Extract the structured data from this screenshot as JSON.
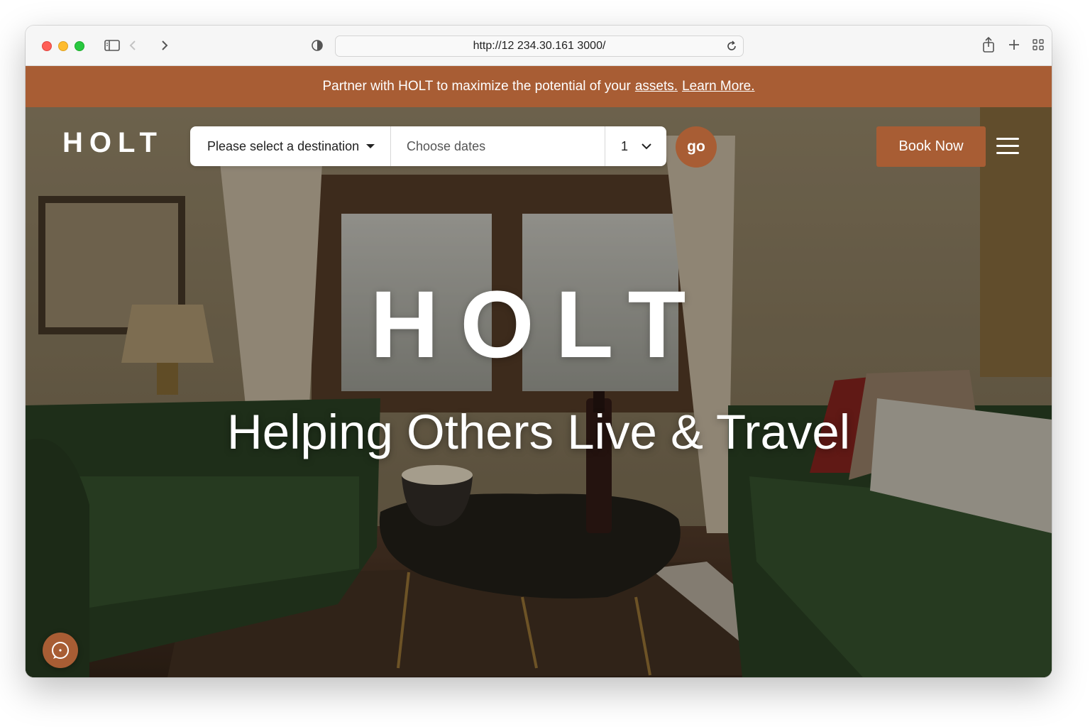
{
  "browser": {
    "url": "http://12 234.30.161 3000/"
  },
  "promo": {
    "text": "Partner with HOLT to maximize the potential of your",
    "assets_link": "assets.",
    "learn_more_link": "Learn More."
  },
  "nav": {
    "logo": "HOLT",
    "destination_placeholder": "Please select a destination",
    "dates_placeholder": "Choose dates",
    "guests_value": "1",
    "go_label": "go",
    "book_label": "Book Now"
  },
  "hero": {
    "title": "HOLT",
    "subtitle": "Helping Others Live & Travel"
  },
  "colors": {
    "brand": "#a85d34",
    "sofa_green": "#2e4a2c"
  },
  "icons": {
    "sidebar": "sidebar-icon",
    "back": "chevron-left-icon",
    "forward": "chevron-right-icon",
    "privacy": "shield-icon",
    "reload": "reload-icon",
    "share": "share-icon",
    "new_tab": "plus-icon",
    "tabs": "grid-icon",
    "menu": "hamburger-icon",
    "chat": "chat-icon"
  }
}
